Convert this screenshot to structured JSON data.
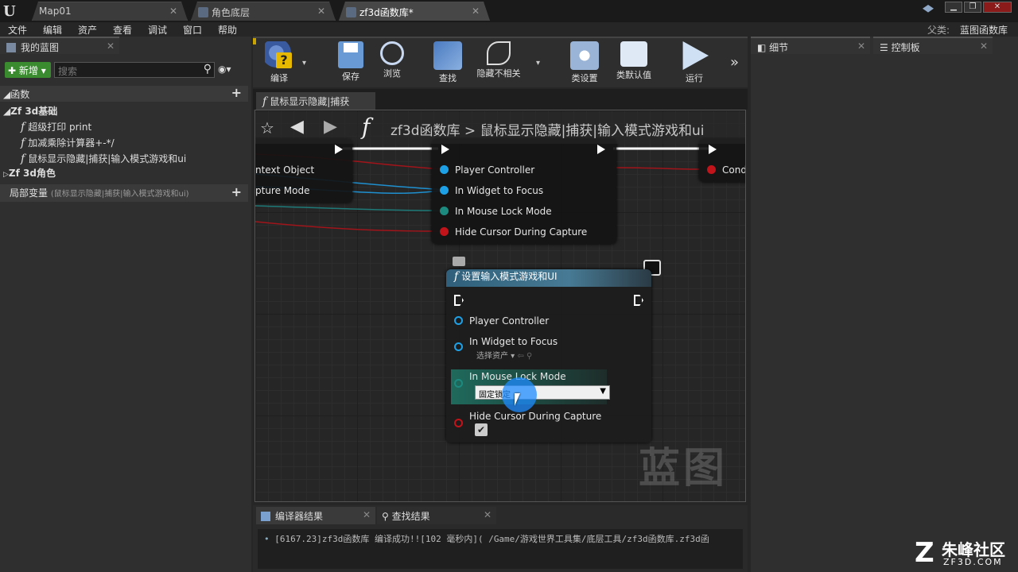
{
  "window": {
    "tabs": [
      {
        "label": "Map01"
      },
      {
        "label": "角色底层"
      },
      {
        "label": "zf3d函数库*"
      }
    ],
    "parent_class_label": "父类:",
    "parent_class_value": "蓝图函数库"
  },
  "menubar": {
    "items": [
      "文件",
      "编辑",
      "资产",
      "查看",
      "调试",
      "窗口",
      "帮助"
    ]
  },
  "my_blueprint": {
    "tab_label": "我的蓝图",
    "new_button": "新增",
    "search_placeholder": "搜索",
    "functions_header": "函数",
    "category1": "Zf 3d基础",
    "functions": [
      "超级打印 print",
      "加减乘除计算器+-*/",
      "鼠标显示隐藏|捕获|输入模式游戏和ui"
    ],
    "category2": "Zf 3d角色",
    "local_vars_label": "局部变量",
    "local_vars_context": "(鼠标显示隐藏|捕获|输入模式游戏和ui)"
  },
  "toolbar": {
    "buttons": [
      "编译",
      "保存",
      "浏览",
      "查找",
      "隐藏不相关",
      "类设置",
      "类默认值",
      "运行"
    ],
    "overflow": "»"
  },
  "graph_tab": {
    "label": "鼠标显示隐藏|捕获"
  },
  "breadcrumb": {
    "root": "zf3d函数库",
    "separator": ">",
    "current": "鼠标显示隐藏|捕获|输入模式游戏和ui"
  },
  "left_node_pins": [
    "ntext Object",
    "pture Mode"
  ],
  "top_node_pins": [
    "Player Controller",
    "In Widget to Focus",
    "In Mouse Lock Mode",
    "Hide Cursor During Capture"
  ],
  "right_node_pin": "Cond",
  "main_node": {
    "title": "设置输入模式游戏和UI",
    "pins": {
      "player_controller": "Player Controller",
      "widget_focus": "In Widget to Focus",
      "widget_select": "选择资产",
      "mouse_lock": "In Mouse Lock Mode",
      "mouse_lock_value": "固定锁定",
      "hide_cursor": "Hide Cursor During Capture"
    },
    "hide_cursor_checked": true
  },
  "watermark": "蓝图",
  "bottom_panel": {
    "tabs": [
      "编译器结果",
      "查找结果"
    ],
    "log": "[6167.23]zf3d函数库 编译成功!![102 毫秒内]( /Game/游戏世界工具集/底层工具/zf3d函数库.zf3d函"
  },
  "details": {
    "tab_label": "细节",
    "tab2_label": "控制板"
  },
  "brand": {
    "name": "朱峰社区",
    "url": "ZF3D.COM"
  },
  "colors": {
    "accent_green": "#2e8b2e",
    "pin_blue": "#1ea0e6",
    "pin_teal": "#1d8a80",
    "pin_red": "#c0141a",
    "node_header": "#2f5f7a"
  }
}
